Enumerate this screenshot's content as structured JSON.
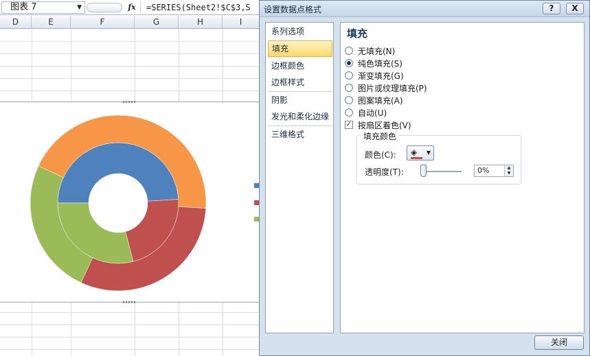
{
  "formula_bar": {
    "name_box": "图表 7",
    "fx_label": "fx",
    "formula": "=SERIES(Sheet2!$C$3,S"
  },
  "columns": [
    "D",
    "E",
    "F",
    "G",
    "H",
    "I"
  ],
  "chart_data": {
    "type": "pie",
    "title": "",
    "rings": [
      {
        "ring": "inner",
        "slices": [
          {
            "color": "#4f81bd",
            "value": 49
          },
          {
            "color": "#c0504d",
            "value": 22
          },
          {
            "color": "#9bbb59",
            "value": 29
          }
        ]
      },
      {
        "ring": "outer",
        "slices": [
          {
            "color": "#f79646",
            "value": 44
          },
          {
            "color": "#c0504d",
            "value": 31
          },
          {
            "color": "#9bbb59",
            "value": 25
          }
        ]
      }
    ],
    "legend_colors": [
      "#4f81bd",
      "#c0504d",
      "#9bbb59"
    ]
  },
  "dialog": {
    "title": "设置数据点格式",
    "help_label": "?",
    "close_x_label": "X",
    "nav_items": [
      {
        "label": "系列选项",
        "selected": false
      },
      {
        "label": "填充",
        "selected": true
      },
      {
        "label": "边框颜色",
        "selected": false
      },
      {
        "label": "边框样式",
        "selected": false
      },
      {
        "label": "阴影",
        "selected": false
      },
      {
        "label": "发光和柔化边缘",
        "selected": false
      },
      {
        "label": "三维格式",
        "selected": false
      }
    ],
    "pane_title": "填充",
    "fill_options": [
      {
        "label": "无填充(N)",
        "type": "radio",
        "checked": false
      },
      {
        "label": "纯色填充(S)",
        "type": "radio",
        "checked": true
      },
      {
        "label": "渐变填充(G)",
        "type": "radio",
        "checked": false
      },
      {
        "label": "图片或纹理填充(P)",
        "type": "radio",
        "checked": false
      },
      {
        "label": "图案填充(A)",
        "type": "radio",
        "checked": false
      },
      {
        "label": "自动(U)",
        "type": "radio",
        "checked": false
      },
      {
        "label": "按扇区着色(V)",
        "type": "checkbox",
        "checked": true
      }
    ],
    "fill_color_group": {
      "legend": "填充颜色",
      "color_label": "颜色(C):",
      "color_swatch": "#c0504d",
      "transparency_label": "透明度(T):",
      "transparency_value": "0%",
      "transparency_level": 0
    },
    "close_button": "关闭"
  }
}
